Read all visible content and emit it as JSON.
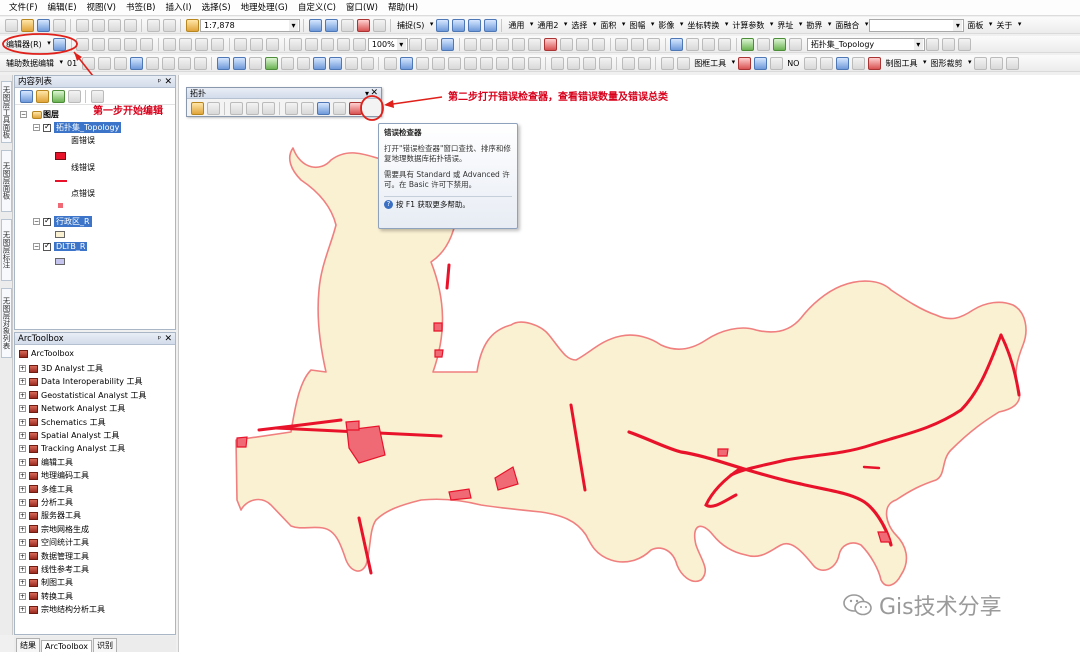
{
  "menu": [
    "文件(F)",
    "编辑(E)",
    "视图(V)",
    "书签(B)",
    "插入(I)",
    "选择(S)",
    "地理处理(G)",
    "自定义(C)",
    "窗口(W)",
    "帮助(H)"
  ],
  "toolbar1": {
    "scale": "1:7,878",
    "snap_label": "捕捉(S)",
    "menus": [
      "通用",
      "通用2",
      "选择",
      "面积",
      "图幅",
      "影像",
      "坐标转换",
      "计算参数",
      "界址",
      "勘界",
      "面融合",
      "面板",
      "关于"
    ]
  },
  "toolbar2": {
    "editor_label": "编辑器(R)",
    "zoom": "100%",
    "layer_combo": "拓扑集_Topology"
  },
  "toolbar3": {
    "aux_label": "辅助数据编辑",
    "marker": "01",
    "menus": [
      "图框工具",
      "NO",
      "制图工具",
      "图形裁剪"
    ]
  },
  "vertical_tabs": [
    "无图层工具面板",
    "无图层面板",
    "无图层标注",
    "无图层对象列表"
  ],
  "toc": {
    "title": "内容列表",
    "root": "图层",
    "layers": [
      {
        "name": "拓扑集_Topology",
        "children": [
          "面错误",
          "线错误",
          "点错误"
        ]
      },
      {
        "name": "行政区_R",
        "children": []
      },
      {
        "name": "DLTB_R",
        "children": []
      }
    ]
  },
  "arctoolbox": {
    "title": "ArcToolbox",
    "root": "ArcToolbox",
    "items": [
      "3D Analyst 工具",
      "Data Interoperability 工具",
      "Geostatistical Analyst 工具",
      "Network Analyst 工具",
      "Schematics 工具",
      "Spatial Analyst 工具",
      "Tracking Analyst 工具",
      "编辑工具",
      "地理编码工具",
      "多维工具",
      "分析工具",
      "服务器工具",
      "宗地网格生成",
      "空间统计工具",
      "数据管理工具",
      "线性参考工具",
      "制图工具",
      "转换工具",
      "宗地结构分析工具"
    ]
  },
  "bottom_tabs": [
    "结果",
    "ArcToolbox",
    "识别"
  ],
  "topology_toolbar": {
    "title": "拓扑"
  },
  "tooltip": {
    "title": "错误检查器",
    "line1": "打开\"错误检查器\"窗口查找、排序和修复地理数据库拓扑错误。",
    "line2": "需要具有 Standard 或 Advanced 许可。在 Basic 许可下禁用。",
    "help": "按 F1 获取更多帮助。"
  },
  "annotations": {
    "step1": "第一步开始编辑",
    "step2": "第二步打开错误检查器，查看错误数量及错误总类"
  },
  "watermark": "Gis技术分享",
  "colors": {
    "parcel_fill": "#faf0d2",
    "parcel_stroke": "#f07f7f",
    "error_line": "#e8132b",
    "error_poly": "#f06a75",
    "annotation": "#d9001b"
  }
}
